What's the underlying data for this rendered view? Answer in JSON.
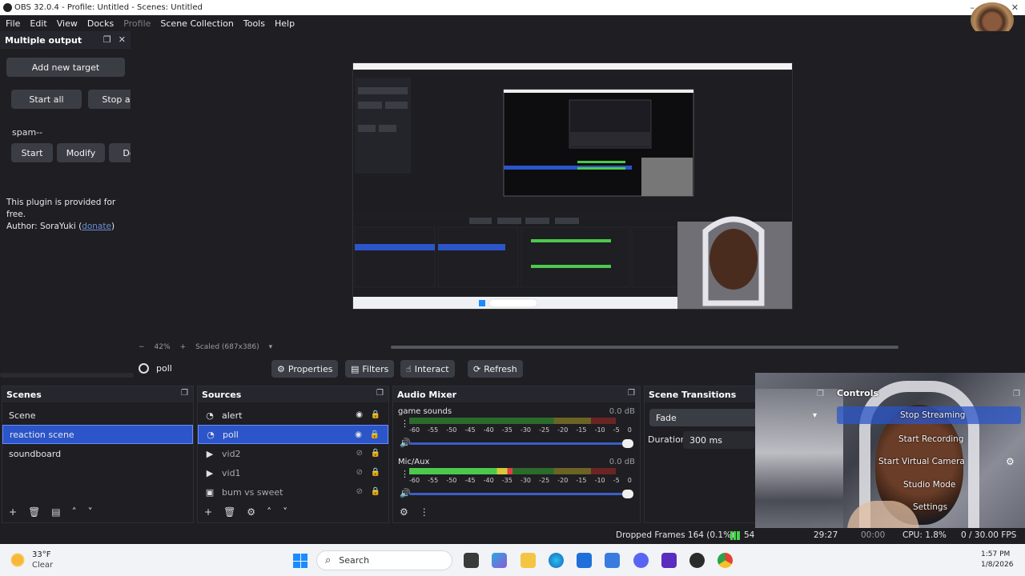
{
  "window": {
    "title": "OBS 32.0.4 - Profile: Untitled - Scenes: Untitled",
    "minimize": "–",
    "restore": "❐",
    "close": "✕"
  },
  "menu": [
    "File",
    "Edit",
    "View",
    "Docks",
    "Profile",
    "Scene Collection",
    "Tools",
    "Help"
  ],
  "multi_output": {
    "title": "Multiple output",
    "add_target": "Add new target",
    "start_all": "Start all",
    "stop_all": "Stop a",
    "target_name": "spam--",
    "start": "Start",
    "modify": "Modify",
    "delete": "De",
    "plugin_line": "This plugin is provided for free.",
    "author_prefix": "Author: SoraYuki (",
    "donate": "donate",
    "author_suffix": ")"
  },
  "zoom": {
    "minus": "−",
    "level": "42%",
    "plus": "+",
    "scaled": "Scaled (687x386)"
  },
  "source_toolbar": {
    "source_name": "poll",
    "properties": "Properties",
    "filters": "Filters",
    "interact": "Interact",
    "refresh": "Refresh"
  },
  "scenes": {
    "title": "Scenes",
    "items": [
      "Scene",
      "reaction scene",
      "soundboard"
    ],
    "selected": "reaction scene"
  },
  "sources": {
    "title": "Sources",
    "items": [
      {
        "name": "alert",
        "icon": "browser-icon",
        "visible": true
      },
      {
        "name": "poll",
        "icon": "browser-icon",
        "visible": true
      },
      {
        "name": "vid2",
        "icon": "play-icon",
        "visible": false
      },
      {
        "name": "vid1",
        "icon": "play-icon",
        "visible": false
      },
      {
        "name": "bum vs sweet",
        "icon": "image-icon",
        "visible": false
      }
    ]
  },
  "mixer": {
    "title": "Audio Mixer",
    "channels": [
      {
        "name": "game sounds",
        "db": "0.0 dB",
        "level": 0
      },
      {
        "name": "Mic/Aux",
        "db": "0.0 dB",
        "level": 0.5
      }
    ],
    "ticks": [
      "-60",
      "-55",
      "-50",
      "-45",
      "-40",
      "-35",
      "-30",
      "-25",
      "-20",
      "-15",
      "-10",
      "-5",
      "0"
    ]
  },
  "transitions": {
    "title": "Scene Transitions",
    "selected": "Fade",
    "duration_label": "Duration",
    "duration_value": "300 ms"
  },
  "controls": {
    "title": "Controls",
    "stop_streaming": "Stop Streaming",
    "start_recording": "Start Recording",
    "start_virtual_camera": "Start Virtual Camera",
    "studio_mode": "Studio Mode",
    "settings": "Settings"
  },
  "status": {
    "dropped_frames": "Dropped Frames 164 (0.1%)",
    "bitrate": "54",
    "stream_time": "29:27",
    "rec_time": "00:00",
    "cpu": "CPU: 1.8%",
    "fps": "0 / 30.00 FPS"
  },
  "taskbar": {
    "temp": "33°F",
    "condition": "Clear",
    "search": "Search",
    "time": "1:57 PM",
    "date": "1/8/2026"
  }
}
